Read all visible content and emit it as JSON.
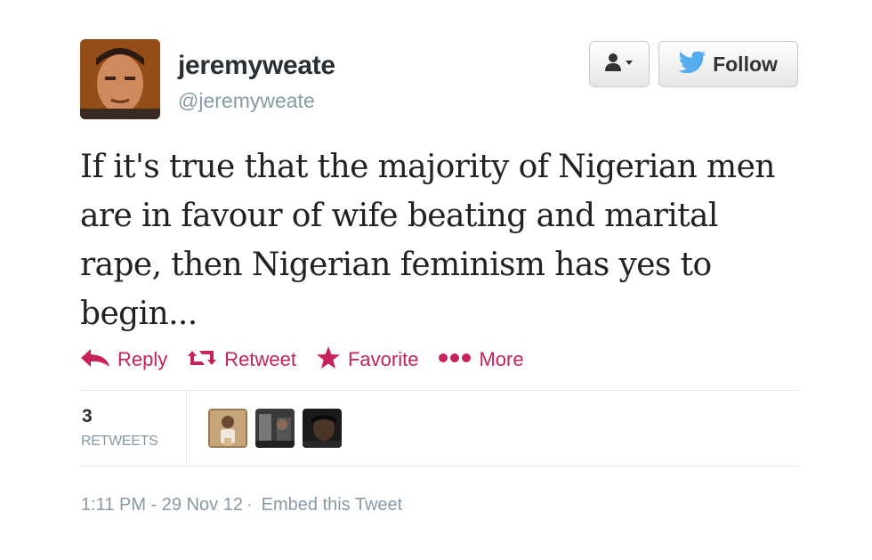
{
  "user": {
    "display_name": "jeremyweate",
    "handle": "@jeremyweate"
  },
  "buttons": {
    "user_menu_icon": "person-dropdown-icon",
    "follow_label": "Follow",
    "follow_icon": "twitter-bird-icon"
  },
  "tweet": {
    "text": "If it's true that the majority of Nigerian men\nare in favour of wife beating and marital\nrape, then Nigerian feminism has yes to\nbegin..."
  },
  "actions": [
    {
      "label": "Reply",
      "icon": "reply-icon"
    },
    {
      "label": "Retweet",
      "icon": "retweet-icon"
    },
    {
      "label": "Favorite",
      "icon": "star-icon"
    },
    {
      "label": "More",
      "icon": "more-dots-icon"
    }
  ],
  "stats": {
    "retweet_count": "3",
    "retweet_label": "RETWEETS"
  },
  "meta": {
    "timestamp": "1:11 PM - 29 Nov 12",
    "separator": "·",
    "embed_label": "Embed this Tweet"
  },
  "colors": {
    "action": "#c8225a",
    "bird": "#55acee",
    "muted": "#8899a6"
  }
}
